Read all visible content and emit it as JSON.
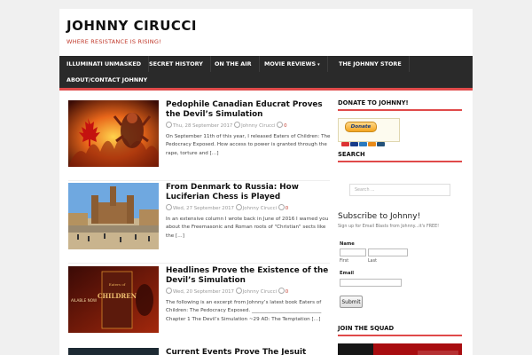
{
  "site": {
    "title": "JOHNNY CIRUCCI",
    "tagline": "WHERE RESISTANCE IS RISING!"
  },
  "nav": {
    "items": [
      {
        "label": "ILLUMINATI UNMASKED"
      },
      {
        "label": "SECRET HISTORY"
      },
      {
        "label": "ON THE AIR"
      },
      {
        "label": "MOVIE REVIEWS",
        "caret": "▾"
      },
      {
        "label": "THE JOHNNY STORE"
      },
      {
        "label": "ABOUT/CONTACT JOHNNY"
      }
    ]
  },
  "posts": [
    {
      "title": "Pedophile Canadian Educrat Proves the Devil’s Simulation",
      "date": "Thu, 28 September 2017",
      "author": "Johnny Cirucci",
      "comments": "0",
      "excerpt": "On September 11th of this year, I released Eaters of Children: The Pedocracy Exposed.  How access to power is granted through the rape, torture and […]"
    },
    {
      "title": "From Denmark to Russia: How Luciferian Chess is Played",
      "date": "Wed, 27 September 2017",
      "author": "Johnny Cirucci",
      "comments": "0",
      "excerpt": "In an extensive column I wrote back in June of 2016 I warned you about the Freemasonic and Roman roots of \"Christian\" sects like the […]"
    },
    {
      "title": "Headlines Prove the Existence of the Devil’s Simulation",
      "date": "Wed, 20 September 2017",
      "author": "Johnny Cirucci",
      "comments": "0",
      "excerpt": "The following is an excerpt from Johnny’s latest book Eaters of Children: The Pedocracy Exposed. ____________________________ Chapter 1 The Devil’s Simulation ~29 AD: The Temptation […]"
    },
    {
      "title": "Current Events Prove The Jesuit",
      "date": "",
      "author": "",
      "comments": "",
      "excerpt": ""
    }
  ],
  "thumbs": {
    "book_cover_text": "CHILDREN",
    "book_cover_subtitle": "Eaters of",
    "book_side_text": "AILABLE NOW"
  },
  "sidebar": {
    "donate_heading": "DONATE TO JOHNNY!",
    "donate_button": "Donate",
    "search_heading": "SEARCH",
    "search_placeholder": "Search ...",
    "subscribe_title": "Subscribe to Johnny!",
    "subscribe_text": "Sign up for Email Blasts from Johnny...it's FREE!",
    "name_label": "Name",
    "first_label": "First",
    "last_label": "Last",
    "email_label": "Email",
    "submit_label": "Submit",
    "squad_heading": "JOIN THE SQUAD"
  },
  "colors": {
    "accent": "#e04a4a",
    "nav_bg": "#2a2a2a",
    "tagline": "#c0392b"
  }
}
